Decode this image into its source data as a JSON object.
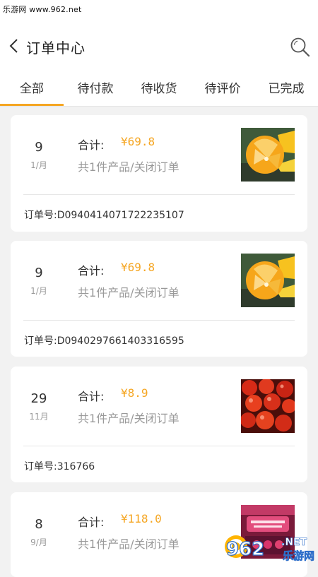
{
  "watermark_top": "乐游网 www.962.net",
  "header": {
    "title": "订单中心"
  },
  "tabs": [
    "全部",
    "待付款",
    "待收货",
    "待评价",
    "已完成"
  ],
  "active_tab": 0,
  "accent_color": "#f5a623",
  "orders": [
    {
      "day": "9",
      "month": "1/月",
      "total_label": "合计:",
      "total": "¥69.8",
      "desc": "共1件产品/关闭订单",
      "order_no": "订单号:D0940414071722235107",
      "image": "orange-slices-image"
    },
    {
      "day": "9",
      "month": "1/月",
      "total_label": "合计:",
      "total": "¥69.8",
      "desc": "共1件产品/关闭订单",
      "order_no": "订单号:D0940297661403316595",
      "image": "orange-slices-image"
    },
    {
      "day": "29",
      "month": "11月",
      "total_label": "合计:",
      "total": "¥8.9",
      "desc": "共1件产品/关闭订单",
      "order_no": "订单号:316766",
      "image": "cherry-tomatoes-image"
    },
    {
      "day": "8",
      "month": "9/月",
      "total_label": "合计:",
      "total": "¥118.0",
      "desc": "共1件产品/关闭订单",
      "order_no": "",
      "image": "packaged-product-image"
    }
  ],
  "watermark_logo": {
    "digits": "962",
    "suffix": ".NET",
    "text": "乐游网"
  }
}
